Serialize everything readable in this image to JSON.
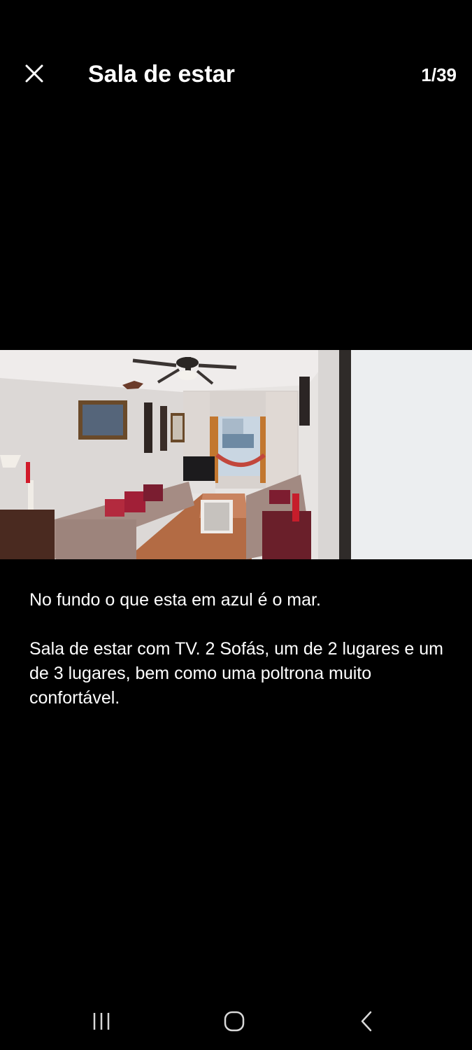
{
  "header": {
    "title": "Sala de estar",
    "counter": "1/39"
  },
  "icons": {
    "close": "close-icon",
    "recents": "recents-icon",
    "home": "home-icon",
    "back": "back-icon"
  },
  "photo": {
    "subject": "living-room-photo"
  },
  "caption": {
    "line1": "No fundo o que esta em azul é o mar.",
    "line2": "Sala de estar com TV. 2 Sofás, um de 2 lugares e um de 3 lugares, bem como uma poltrona muito confortável."
  },
  "colors": {
    "background": "#000000",
    "text": "#ffffff"
  }
}
